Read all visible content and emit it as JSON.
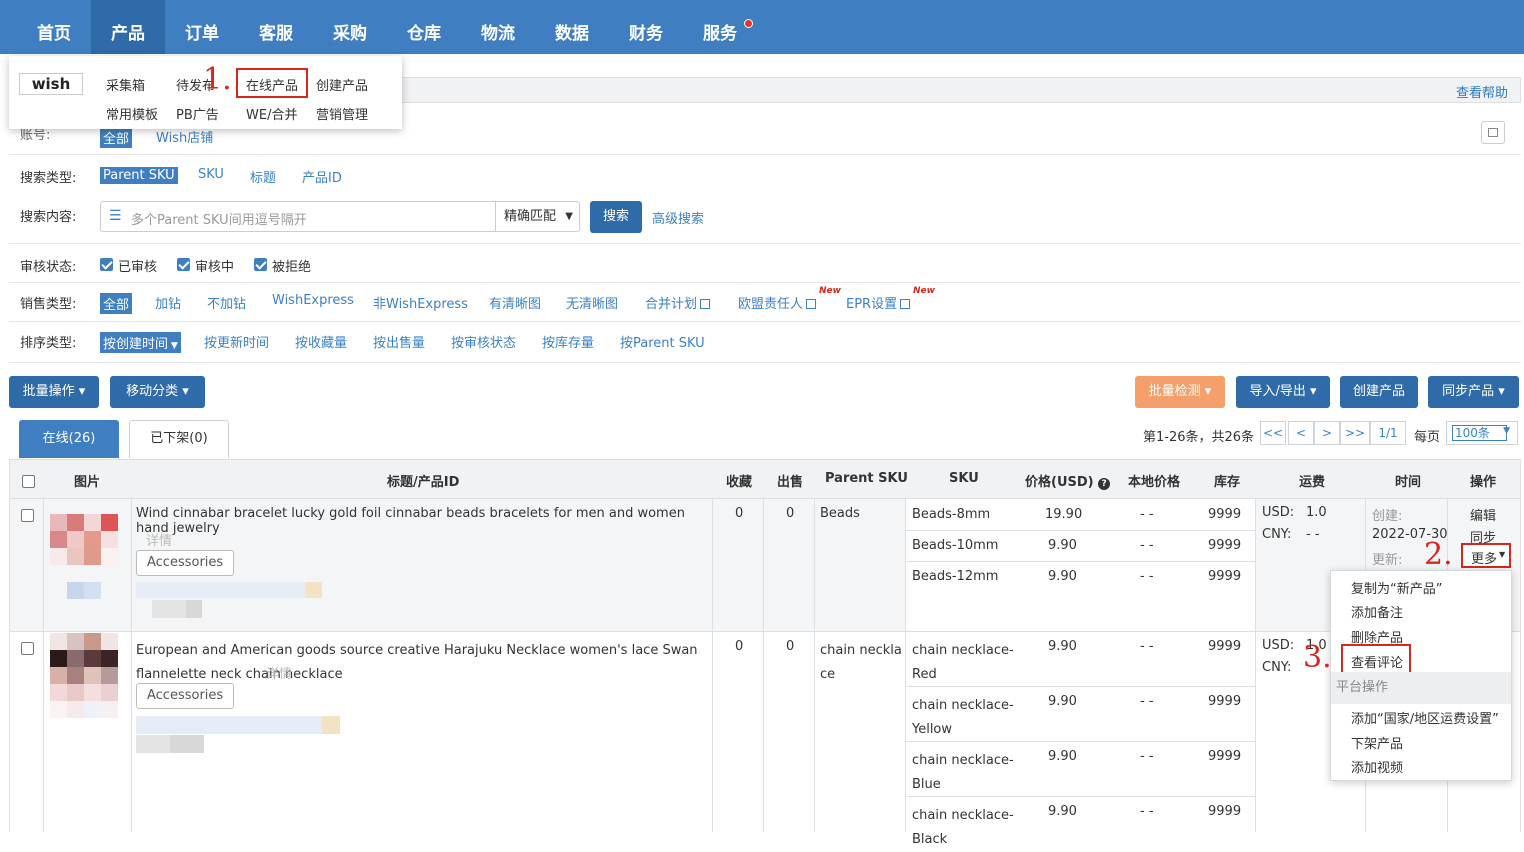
{
  "nav": {
    "items": [
      "首页",
      "产品",
      "订单",
      "客服",
      "采购",
      "仓库",
      "物流",
      "数据",
      "财务",
      "服务"
    ],
    "active": "产品"
  },
  "product_menu": {
    "platform": "wish",
    "row1": [
      "采集箱",
      "待发布",
      "在线产品",
      "创建产品"
    ],
    "row2": [
      "常用模板",
      "PB广告",
      "WE/合并",
      "营销管理"
    ],
    "highlighted": "在线产品"
  },
  "steps": [
    "1.",
    "2.",
    "3."
  ],
  "help": "查看帮助",
  "filters": {
    "account": {
      "label": "账号:",
      "options": [
        "全部",
        "Wish店铺"
      ]
    },
    "search_type": {
      "label": "搜索类型:",
      "options": [
        "Parent SKU",
        "SKU",
        "标题",
        "产品ID"
      ]
    },
    "search_content": {
      "label": "搜索内容:",
      "placeholder": "多个Parent SKU间用逗号隔开",
      "match": "精确匹配",
      "search_btn": "搜索",
      "advanced": "高级搜索"
    },
    "review_status": {
      "label": "审核状态:",
      "options": [
        "已审核",
        "审核中",
        "被拒绝"
      ]
    },
    "sale_type": {
      "label": "销售类型:",
      "options": [
        "全部",
        "加钻",
        "不加钻",
        "WishExpress",
        "非WishExpress",
        "有清晰图",
        "无清晰图",
        "合并计划",
        "欧盟责任人",
        "EPR设置"
      ],
      "new_badge": "New"
    },
    "sort_type": {
      "label": "排序类型:",
      "options": [
        "按创建时间",
        "按更新时间",
        "按收藏量",
        "按出售量",
        "按审核状态",
        "按库存量",
        "按Parent SKU"
      ]
    }
  },
  "toolbar": {
    "batch": "批量操作",
    "move": "移动分类",
    "check": "批量检测",
    "import_export": "导入/导出",
    "create": "创建产品",
    "sync": "同步产品"
  },
  "tabs": {
    "online": "在线(26)",
    "offline": "已下架(0)"
  },
  "pager": {
    "summary": "第1-26条，共26条",
    "first": "<<",
    "prev": "<",
    "next": ">",
    "last": ">>",
    "page": "1/1",
    "per_page_label": "每页",
    "per_page": "100条"
  },
  "table": {
    "headers": [
      "图片",
      "标题/产品ID",
      "收藏",
      "出售",
      "Parent SKU",
      "SKU",
      "价格(USD)",
      "本地价格",
      "库存",
      "运费",
      "时间",
      "操作"
    ],
    "rows": [
      {
        "title": "Wind cinnabar bracelet lucky gold foil cinnabar beads bracelets for men and women hand jewelry",
        "detail": "详情",
        "category": "Accessories",
        "fav": "0",
        "sold": "0",
        "parent_sku": "Beads",
        "variants": [
          {
            "sku": "Beads-8mm",
            "price": "19.90",
            "local": "- -",
            "stock": "9999"
          },
          {
            "sku": "Beads-10mm",
            "price": "9.90",
            "local": "- -",
            "stock": "9999"
          },
          {
            "sku": "Beads-12mm",
            "price": "9.90",
            "local": "- -",
            "stock": "9999"
          }
        ],
        "ship_usd": "USD:",
        "ship_usd_val": "1.0",
        "ship_cny": "CNY:",
        "ship_cny_val": "- -",
        "created_label": "创建:",
        "created": "2022-07-30",
        "updated_label": "更新:",
        "actions": [
          "编辑",
          "同步",
          "更多"
        ]
      },
      {
        "title": "European and American goods source creative Harajuku Necklace women's lace Swan flannelette neck chain necklace",
        "detail": "详情",
        "category": "Accessories",
        "fav": "0",
        "sold": "0",
        "parent_sku": "chain necklace",
        "variants": [
          {
            "sku": "chain necklace-Red",
            "price": "9.90",
            "local": "- -",
            "stock": "9999"
          },
          {
            "sku": "chain necklace-Yellow",
            "price": "9.90",
            "local": "- -",
            "stock": "9999"
          },
          {
            "sku": "chain necklace-Blue",
            "price": "9.90",
            "local": "- -",
            "stock": "9999"
          },
          {
            "sku": "chain necklace-Black",
            "price": "9.90",
            "local": "- -",
            "stock": "9999"
          }
        ],
        "ship_usd": "USD:",
        "ship_usd_val": "1.0",
        "ship_cny": "CNY:"
      }
    ]
  },
  "more_menu": {
    "items": [
      "复制为“新产品”",
      "添加备注",
      "删除产品",
      "查看评论"
    ],
    "platform_header": "平台操作",
    "platform_items": [
      "添加“国家/地区运费设置”",
      "下架产品",
      "添加视频"
    ]
  }
}
